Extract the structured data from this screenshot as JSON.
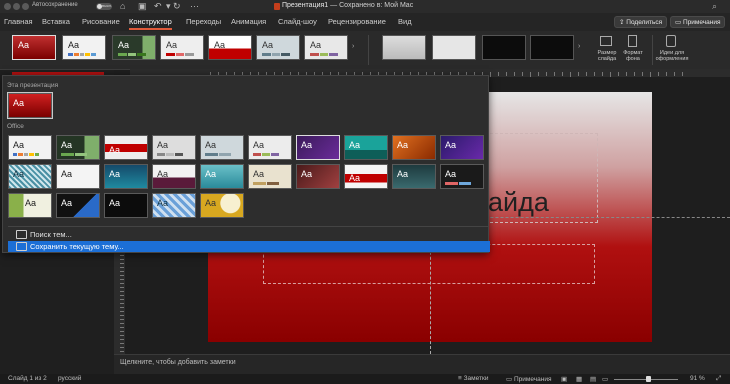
{
  "titlebar": {
    "autosave_label": "Автосохранение",
    "autosave_state": "выкл.",
    "doc_name": "Презентация1",
    "doc_status": "— Сохранено в: Мой Mac"
  },
  "tabs": [
    "Главная",
    "Вставка",
    "Рисование",
    "Конструктор",
    "Переходы",
    "Анимация",
    "Слайд-шоу",
    "Рецензирование",
    "Вид"
  ],
  "active_tab": "Конструктор",
  "header_buttons": {
    "share": "Поделиться",
    "comments": "Примечания"
  },
  "ribbon": {
    "themes_aa": "Aa",
    "slide_size": "Размер слайда",
    "format_bg": "Формат фона",
    "design_ideas": "Идеи для оформления"
  },
  "dropdown": {
    "this_presentation_label": "Эта презентация",
    "office_label": "Office",
    "theme_aa": "Aa",
    "browse_themes": "Поиск тем...",
    "save_theme": "Сохранить текущую тему..."
  },
  "slide": {
    "title_fragment": "айда"
  },
  "notes": {
    "placeholder": "Щелкните, чтобы добавить заметки"
  },
  "status": {
    "slide_counter": "Слайд 1 из 2",
    "language": "русский",
    "notes_btn": "Заметки",
    "comments_btn": "Примечания",
    "zoom": "91 %"
  },
  "colors": {
    "accent": "#e05a3a",
    "selection": "#1c6fd6",
    "theme_red": "#b01010"
  }
}
